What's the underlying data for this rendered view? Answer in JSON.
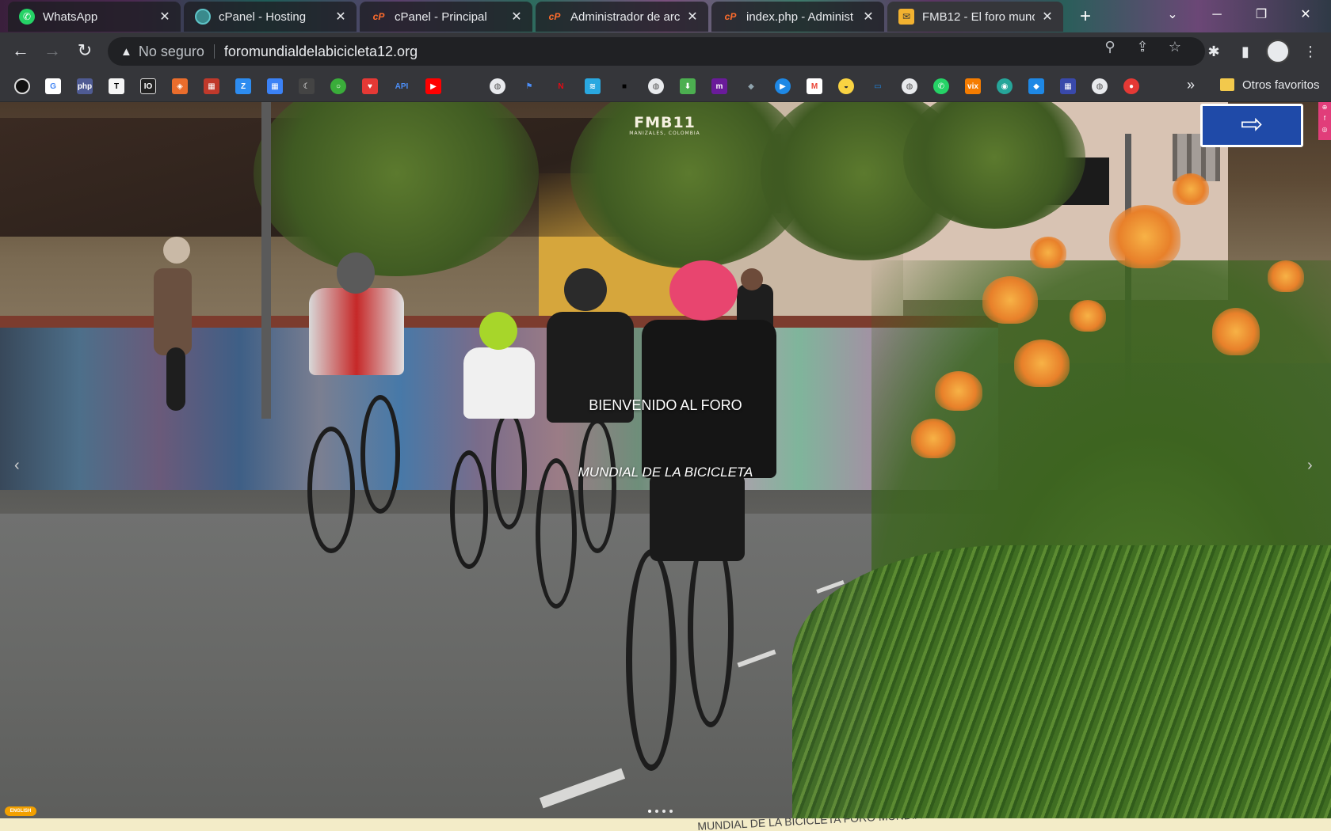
{
  "browser": {
    "tabs": [
      {
        "title": "WhatsApp",
        "icon": "whatsapp-icon",
        "color": "#25D366",
        "active": false
      },
      {
        "title": "cPanel - Hosting",
        "icon": "cpanel-hosting-icon",
        "color": "#5ec4c8",
        "active": false
      },
      {
        "title": "cPanel - Principal",
        "icon": "cpanel-icon",
        "color": "#ff6c2c",
        "active": false
      },
      {
        "title": "Administrador de arc",
        "icon": "cpanel-icon",
        "color": "#ff6c2c",
        "active": false
      },
      {
        "title": "index.php - Administ",
        "icon": "cpanel-icon",
        "color": "#ff6c2c",
        "active": false
      },
      {
        "title": "FMB12 - El foro munc",
        "icon": "fmb-icon",
        "color": "#f2b230",
        "active": true
      }
    ],
    "close_glyph": "✕",
    "new_tab_glyph": "+",
    "address": {
      "security_label": "No seguro",
      "url": "foromundialdelabicicleta12.org"
    },
    "bookmarks_overflow": "»",
    "other_bookmarks": "Otros favoritos"
  },
  "page": {
    "logo_text": "FMB11",
    "logo_subtext": "MANIZALES, COLOMBIA",
    "hero_title": "BIENVENIDO AL FORO",
    "hero_subtitle": "MUNDIAL DE LA BICICLETA",
    "language_button": "ENGLISH",
    "ticker_text": "MUNDIAL DE LA BICICLETA FORO MUNDIAL"
  }
}
